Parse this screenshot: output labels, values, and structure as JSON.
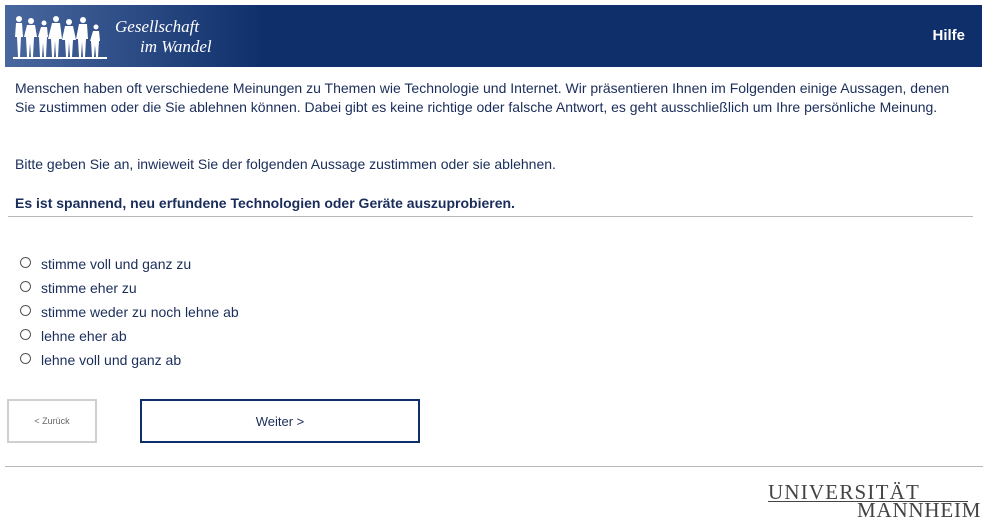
{
  "header": {
    "logo_line1": "Gesellschaft",
    "logo_line2": "im Wandel",
    "help_label": "Hilfe",
    "logo_icon": "people-silhouettes-icon"
  },
  "intro": "Menschen haben oft verschiedene Meinungen zu Themen wie Technologie und Internet. Wir präsentieren Ihnen im Folgenden einige Aussagen, denen Sie zustimmen oder die Sie ablehnen können. Dabei gibt es keine richtige oder falsche Antwort, es geht ausschließlich um Ihre persönliche Meinung.",
  "instruction": "Bitte geben Sie an, inwieweit Sie der folgenden Aussage zustimmen oder sie ablehnen.",
  "question": "Es ist spannend, neu erfundene Technologien oder Geräte auszuprobieren.",
  "options": [
    "stimme voll und ganz zu",
    "stimme eher zu",
    "stimme weder zu noch lehne ab",
    "lehne eher ab",
    "lehne voll und ganz ab"
  ],
  "nav": {
    "back_label": "< Zurück",
    "next_label": "Weiter >"
  },
  "footer": {
    "university_line1": "UNIVERSITÄT",
    "university_line2": "MANNHEIM"
  },
  "colors": {
    "header_bg": "#0f2f6b",
    "text": "#1a2d5a",
    "rule": "#b8b8b8"
  }
}
